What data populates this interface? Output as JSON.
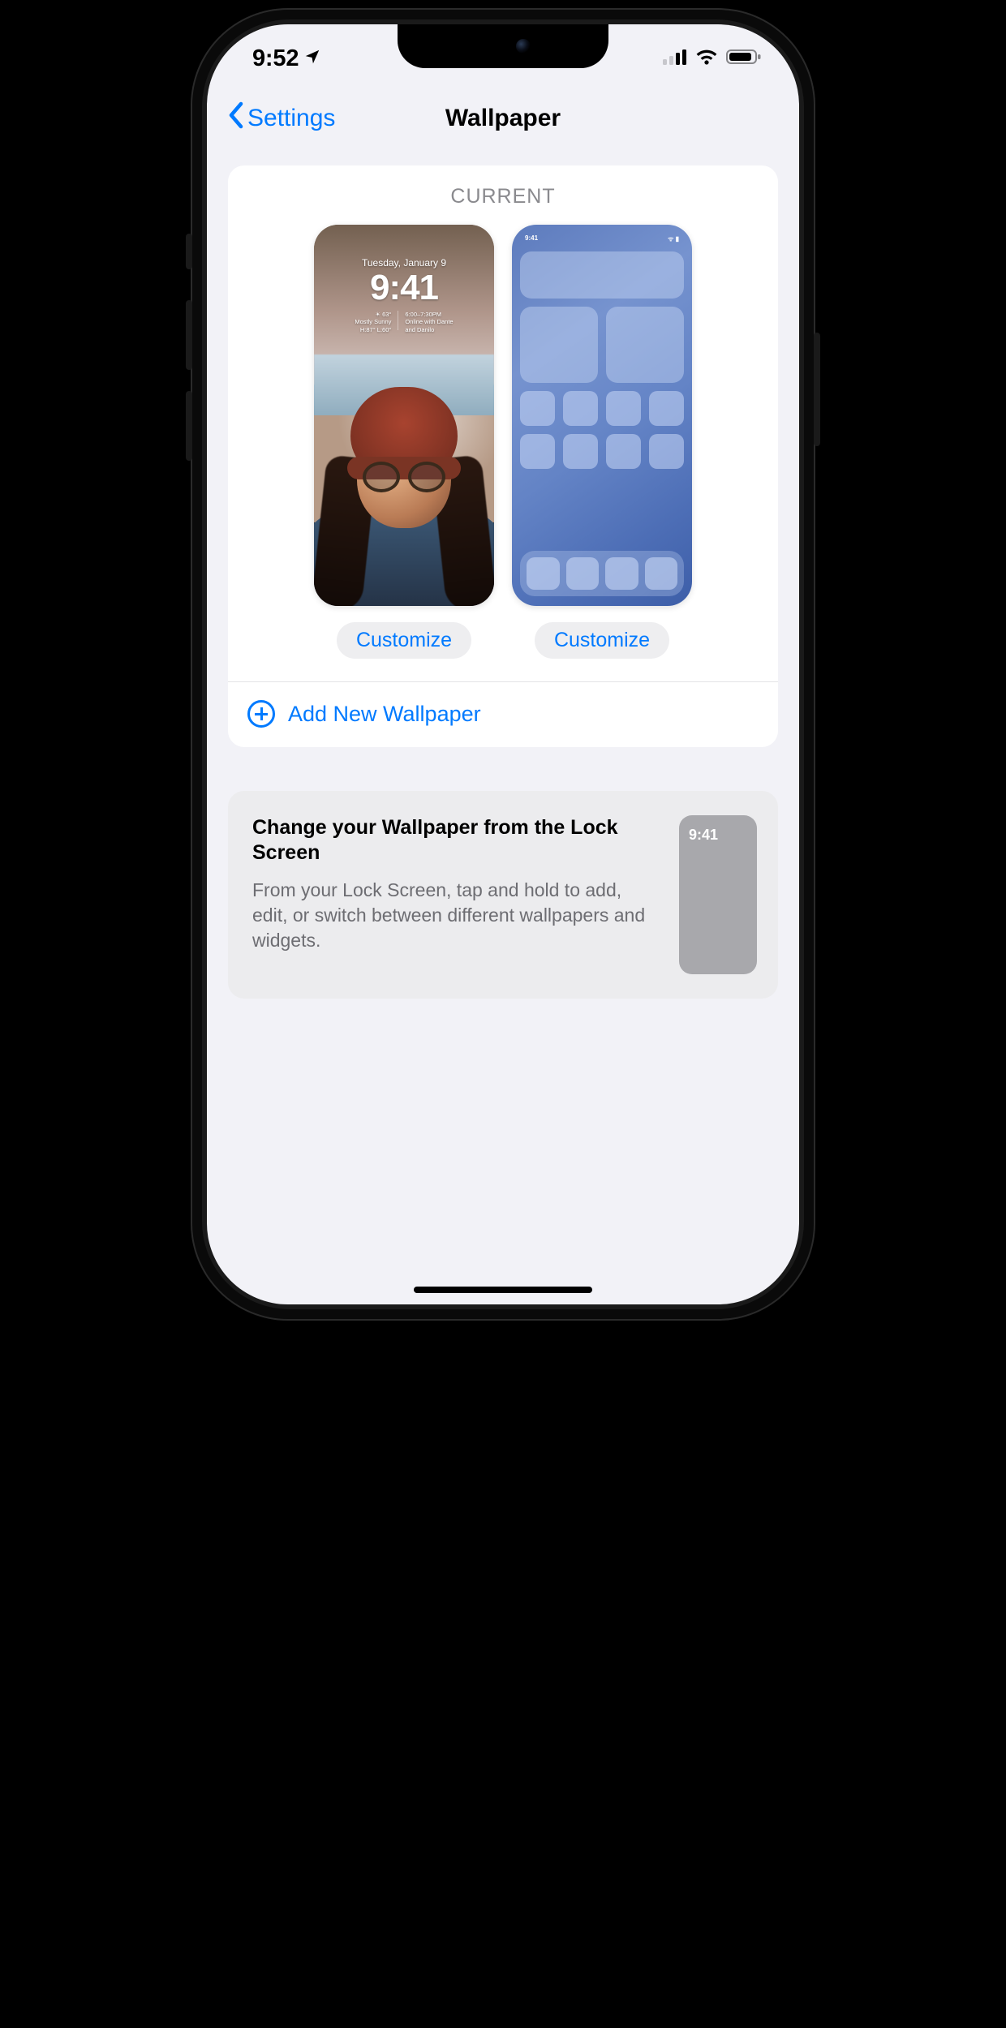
{
  "status_bar": {
    "time": "9:52"
  },
  "nav": {
    "back_label": "Settings",
    "title": "Wallpaper"
  },
  "card": {
    "section_label": "CURRENT",
    "lock_preview": {
      "date": "Tuesday, January 9",
      "time": "9:41",
      "weather_line1": "63°",
      "weather_line2": "Mostly Sunny",
      "weather_line3": "H:87° L:60°",
      "cal_line1": "6:00–7:30PM",
      "cal_line2": "Online with Dante",
      "cal_line3": "and Danilo"
    },
    "home_preview": {
      "time": "9:41"
    },
    "customize_lock_label": "Customize",
    "customize_home_label": "Customize",
    "add_new_label": "Add New Wallpaper"
  },
  "tip": {
    "title": "Change your Wallpaper from the Lock Screen",
    "body": "From your Lock Screen, tap and hold to add, edit, or switch between different wallpapers and widgets.",
    "thumb_time": "9:41"
  }
}
